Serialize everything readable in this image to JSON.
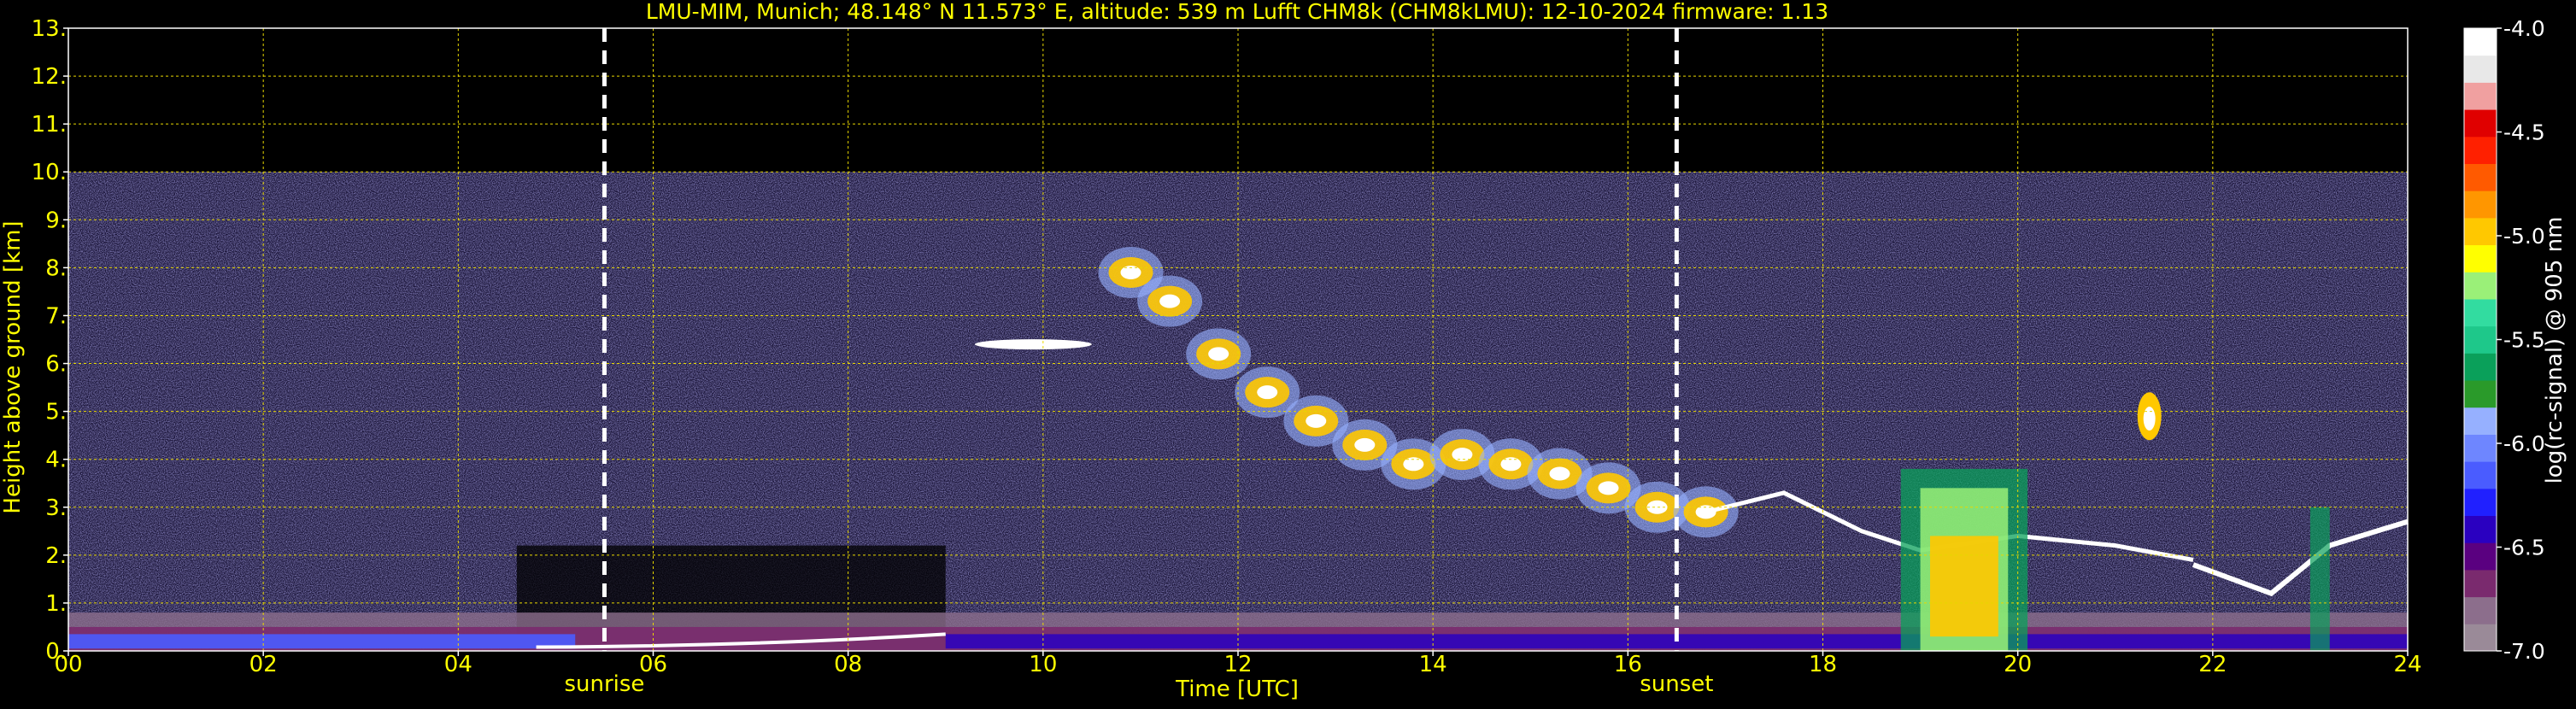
{
  "chart_data": {
    "type": "heatmap",
    "title": "LMU-MIM, Munich; 48.148° N 11.573° E, altitude: 539 m    Lufft CHM8k (CHM8kLMU): 12-10-2024    firmware: 1.13",
    "xlabel": "Time [UTC]",
    "ylabel": "Height above ground [km]",
    "xlim": [
      0,
      24
    ],
    "ylim": [
      0,
      13
    ],
    "x_ticks": [
      0,
      2,
      4,
      6,
      8,
      10,
      12,
      14,
      16,
      18,
      20,
      22,
      24
    ],
    "x_tick_labels": [
      "00",
      "02",
      "04",
      "06",
      "08",
      "10",
      "12",
      "14",
      "16",
      "18",
      "20",
      "22",
      "24"
    ],
    "y_ticks": [
      0,
      1,
      2,
      3,
      4,
      5,
      6,
      7,
      8,
      9,
      10,
      11,
      12,
      13
    ],
    "y_tick_labels": [
      "0.",
      "1.",
      "2.",
      "3.",
      "4.",
      "5.",
      "6.",
      "7.",
      "8.",
      "9.",
      "10.",
      "11.",
      "12.",
      "13."
    ],
    "grid": true,
    "measurement_top_km": 10,
    "events": [
      {
        "label": "sunrise",
        "time": 5.5
      },
      {
        "label": "sunset",
        "time": 16.5
      }
    ],
    "colorbar": {
      "label": "log(rc-signal) @ 905 nm",
      "range": [
        -7.0,
        -4.0
      ],
      "tick_values": [
        -4.0,
        -4.5,
        -5.0,
        -5.5,
        -6.0,
        -6.5,
        -7.0
      ],
      "tick_labels": [
        "-4.0",
        "-4.5",
        "-5.0",
        "-5.5",
        "-6.0",
        "-6.5",
        "-7.0"
      ],
      "colors": [
        "#9a8a98",
        "#8c6e8c",
        "#7a2a6e",
        "#5a0080",
        "#2a00c0",
        "#2020ff",
        "#4a5cff",
        "#6e86ff",
        "#96b0ff",
        "#2a9a2a",
        "#0aa05a",
        "#1ec88a",
        "#32dca0",
        "#9af078",
        "#ffff00",
        "#ffc800",
        "#ff9600",
        "#ff5a00",
        "#ff2000",
        "#e00000",
        "#f0a0a0",
        "#e8e8e8",
        "#ffffff"
      ]
    },
    "features": [
      {
        "name": "boundary layer aerosol",
        "time_range": [
          0,
          24
        ],
        "height_range_km": [
          0,
          0.8
        ]
      },
      {
        "name": "cloud near 6 km",
        "time_range": [
          9.6,
          10.2
        ],
        "height_km": 6.4
      },
      {
        "name": "descending cloud layer",
        "time_range": [
          10.8,
          17.0
        ],
        "height_range_km": [
          8.0,
          2.8
        ]
      },
      {
        "name": "low cloud / precipitation",
        "time_range": [
          18.8,
          20.1
        ],
        "height_range_km": [
          0,
          3.8
        ]
      },
      {
        "name": "cloud near 5 km",
        "time_range": [
          21.2,
          21.5
        ],
        "height_km": 4.9
      },
      {
        "name": "low cloud layer",
        "time_range": [
          21.8,
          24
        ],
        "height_range_km": [
          1.0,
          2.8
        ]
      }
    ]
  }
}
